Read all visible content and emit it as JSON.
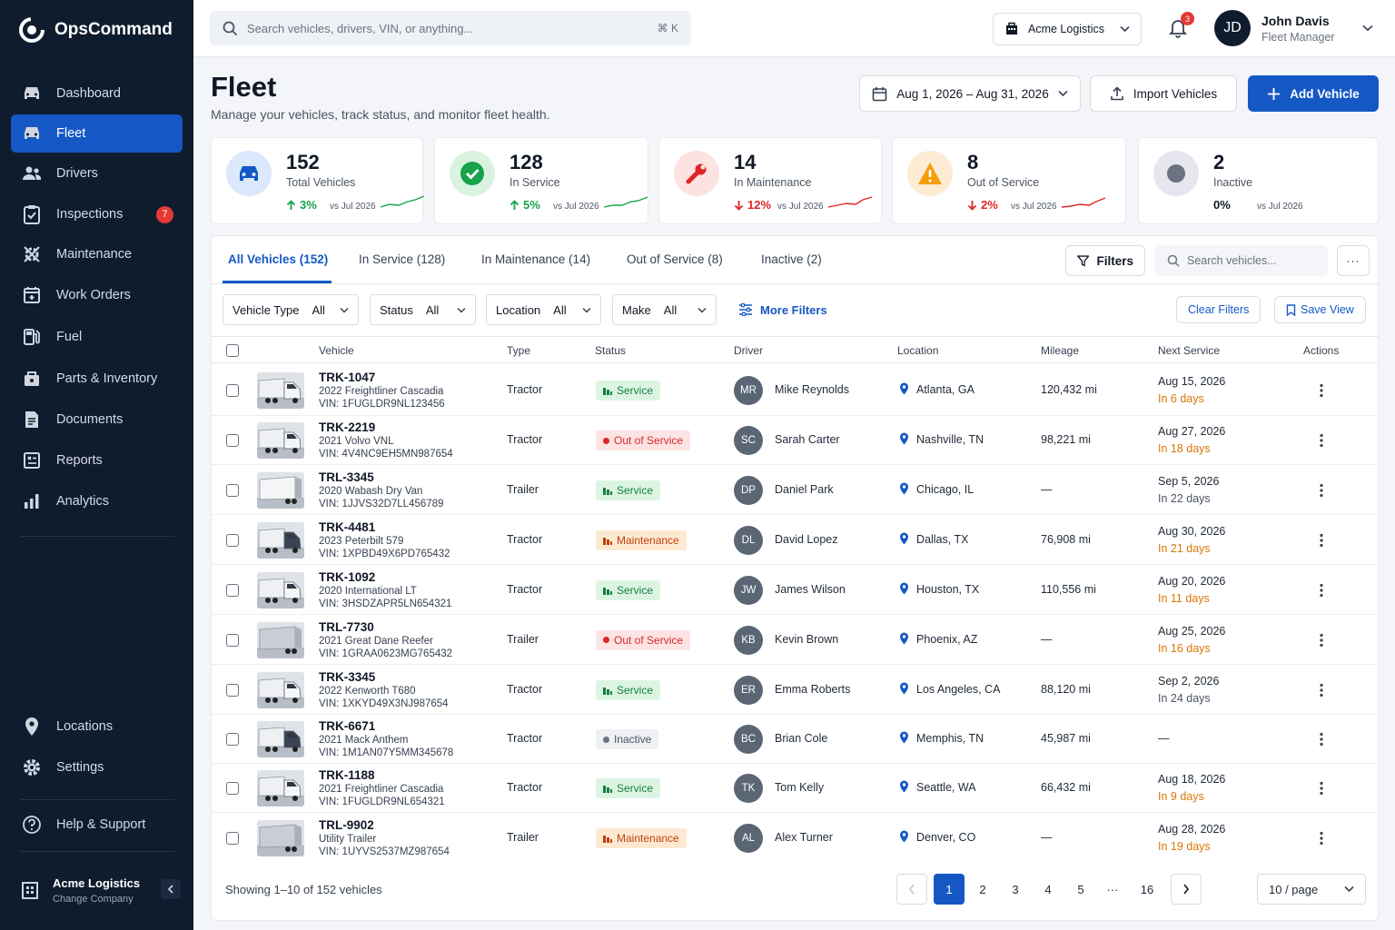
{
  "app": {
    "name": "OpsCommand"
  },
  "sidebar": {
    "items": [
      {
        "label": "Dashboard",
        "icon": "car-icon"
      },
      {
        "label": "Fleet",
        "icon": "car-icon",
        "active": true
      },
      {
        "label": "Drivers",
        "icon": "people-icon"
      },
      {
        "label": "Inspections",
        "icon": "clipboard-check-icon",
        "badge": "7"
      },
      {
        "label": "Maintenance",
        "icon": "gear-wrench-icon"
      },
      {
        "label": "Work Orders",
        "icon": "calendar-icon"
      },
      {
        "label": "Fuel",
        "icon": "fuel-pump-icon"
      },
      {
        "label": "Parts & Inventory",
        "icon": "box-icon"
      },
      {
        "label": "Documents",
        "icon": "document-icon"
      },
      {
        "label": "Reports",
        "icon": "report-icon"
      },
      {
        "label": "Analytics",
        "icon": "bar-chart-icon"
      }
    ],
    "bottom": [
      {
        "label": "Locations",
        "icon": "pin-icon"
      },
      {
        "label": "Settings",
        "icon": "gear-icon"
      },
      {
        "label": "Help & Support",
        "icon": "help-icon"
      }
    ],
    "company": {
      "name": "Acme Logistics",
      "action": "Change Company"
    }
  },
  "topbar": {
    "search_placeholder": "Search vehicles, drivers, VIN, or anything...",
    "shortcut": "⌘ K",
    "org": "Acme Logistics",
    "notifications": "3",
    "user": {
      "initials": "JD",
      "name": "John Davis",
      "role": "Fleet Manager"
    }
  },
  "header": {
    "title": "Fleet",
    "subtitle": "Manage your vehicles, track status, and monitor fleet health.",
    "date_range": "Aug 1, 2026 – Aug 31, 2026",
    "import_label": "Import Vehicles",
    "add_label": "Add Vehicle"
  },
  "stats": [
    {
      "value": "152",
      "label": "Total Vehicles",
      "trend": "3%",
      "dir": "up",
      "vs": "vs Jul 2026",
      "color": "#1558c5",
      "bg": "#dce8fb"
    },
    {
      "value": "128",
      "label": "In Service",
      "trend": "5%",
      "dir": "up",
      "vs": "vs Jul 2026",
      "color": "#16a34a",
      "bg": "#daf3e1"
    },
    {
      "value": "14",
      "label": "In Maintenance",
      "trend": "12%",
      "dir": "down",
      "vs": "vs Jul 2026",
      "color": "#dc2626",
      "bg": "#fde2e2"
    },
    {
      "value": "8",
      "label": "Out of Service",
      "trend": "2%",
      "dir": "down",
      "vs": "vs Jul 2026",
      "color": "#f59e0b",
      "bg": "#fdebd3"
    },
    {
      "value": "2",
      "label": "Inactive",
      "trend": "0%",
      "dir": "flat",
      "vs": "vs Jul 2026",
      "color": "#6b7280",
      "bg": "#e6e7ee"
    }
  ],
  "tabs": [
    "All Vehicles (152)",
    "In Service (128)",
    "In Maintenance (14)",
    "Out of Service (8)",
    "Inactive (2)"
  ],
  "toolbar": {
    "filters": "Filters",
    "search_placeholder": "Search vehicles...",
    "more": "···"
  },
  "filters": [
    {
      "key": "Vehicle Type",
      "value": "All"
    },
    {
      "key": "Status",
      "value": "All"
    },
    {
      "key": "Location",
      "value": "All"
    },
    {
      "key": "Make",
      "value": "All"
    }
  ],
  "more_filters": "More Filters",
  "clear_filters": "Clear Filters",
  "save_view": "Save View",
  "columns": [
    "Vehicle",
    "Type",
    "Status",
    "Driver",
    "Location",
    "Mileage",
    "Next Service",
    "Actions"
  ],
  "rows": [
    {
      "id": "TRK-1047",
      "model": "2022 Freightliner Cascadia",
      "vin": "VIN: 1FUGLDR9NL123456",
      "type": "Tractor",
      "status": "Service",
      "status_kind": "service",
      "initials": "MR",
      "driver": "Mike Reynolds",
      "location": "Atlanta, GA",
      "mileage": "120,432 mi",
      "next": "Aug 15, 2026",
      "within": "In 6 days",
      "warn": true,
      "truck": "cab"
    },
    {
      "id": "TRK-2219",
      "model": "2021 Volvo VNL",
      "vin": "VIN: 4V4NC9EH5MN987654",
      "type": "Tractor",
      "status": "Out of Service",
      "status_kind": "out",
      "initials": "SC",
      "driver": "Sarah Carter",
      "location": "Nashville, TN",
      "mileage": "98,221 mi",
      "next": "Aug 27, 2026",
      "within": "In 18 days",
      "warn": true,
      "truck": "cab"
    },
    {
      "id": "TRL-3345",
      "model": "2020 Wabash Dry Van",
      "vin": "VIN: 1JJVS32D7LL456789",
      "type": "Trailer",
      "status": "Service",
      "status_kind": "service",
      "initials": "DP",
      "driver": "Daniel Park",
      "location": "Chicago, IL",
      "mileage": "—",
      "next": "Sep 5, 2026",
      "within": "In 22 days",
      "warn": false,
      "truck": "trailer"
    },
    {
      "id": "TRK-4481",
      "model": "2023 Peterbilt 579",
      "vin": "VIN: 1XPBD49X6PD765432",
      "type": "Tractor",
      "status": "Maintenance",
      "status_kind": "maint",
      "initials": "DL",
      "driver": "David Lopez",
      "location": "Dallas, TX",
      "mileage": "76,908 mi",
      "next": "Aug 30, 2026",
      "within": "In 21 days",
      "warn": true,
      "truck": "cab-dark"
    },
    {
      "id": "TRK-1092",
      "model": "2020 International LT",
      "vin": "VIN: 3HSDZAPR5LN654321",
      "type": "Tractor",
      "status": "Service",
      "status_kind": "service",
      "initials": "JW",
      "driver": "James Wilson",
      "location": "Houston, TX",
      "mileage": "110,556 mi",
      "next": "Aug 20, 2026",
      "within": "In 11 days",
      "warn": true,
      "truck": "cab"
    },
    {
      "id": "TRL-7730",
      "model": "2021 Great Dane Reefer",
      "vin": "VIN: 1GRAA0623MG765432",
      "type": "Trailer",
      "status": "Out of Service",
      "status_kind": "out",
      "initials": "KB",
      "driver": "Kevin Brown",
      "location": "Phoenix, AZ",
      "mileage": "—",
      "next": "Aug 25, 2026",
      "within": "In 16 days",
      "warn": true,
      "truck": "trailer-grey"
    },
    {
      "id": "TRK-3345",
      "model": "2022 Kenworth T680",
      "vin": "VIN: 1XKYD49X3NJ987654",
      "type": "Tractor",
      "status": "Service",
      "status_kind": "service",
      "initials": "ER",
      "driver": "Emma Roberts",
      "location": "Los Angeles, CA",
      "mileage": "88,120 mi",
      "next": "Sep 2, 2026",
      "within": "In 24 days",
      "warn": false,
      "truck": "cab"
    },
    {
      "id": "TRK-6671",
      "model": "2021 Mack Anthem",
      "vin": "VIN: 1M1AN07Y5MM345678",
      "type": "Tractor",
      "status": "Inactive",
      "status_kind": "inactive",
      "initials": "BC",
      "driver": "Brian Cole",
      "location": "Memphis, TN",
      "mileage": "45,987 mi",
      "next": "—",
      "within": "",
      "warn": false,
      "truck": "cab-dark"
    },
    {
      "id": "TRK-1188",
      "model": "2021 Freightliner Cascadia",
      "vin": "VIN: 1FUGLDR9NL654321",
      "type": "Tractor",
      "status": "Service",
      "status_kind": "service",
      "initials": "TK",
      "driver": "Tom Kelly",
      "location": "Seattle, WA",
      "mileage": "66,432 mi",
      "next": "Aug 18, 2026",
      "within": "In 9 days",
      "warn": true,
      "truck": "cab"
    },
    {
      "id": "TRL-9902",
      "model": "Utility Trailer",
      "vin": "VIN: 1UYVS2537MZ987654",
      "type": "Trailer",
      "status": "Maintenance",
      "status_kind": "maint",
      "initials": "AL",
      "driver": "Alex Turner",
      "location": "Denver, CO",
      "mileage": "—",
      "next": "Aug 28, 2026",
      "within": "In 19 days",
      "warn": true,
      "truck": "trailer-grey"
    }
  ],
  "footer": {
    "showing": "Showing 1–10 of 152 vehicles",
    "pages": [
      "1",
      "2",
      "3",
      "4",
      "5",
      "···",
      "16"
    ],
    "per_page": "10 / page"
  }
}
